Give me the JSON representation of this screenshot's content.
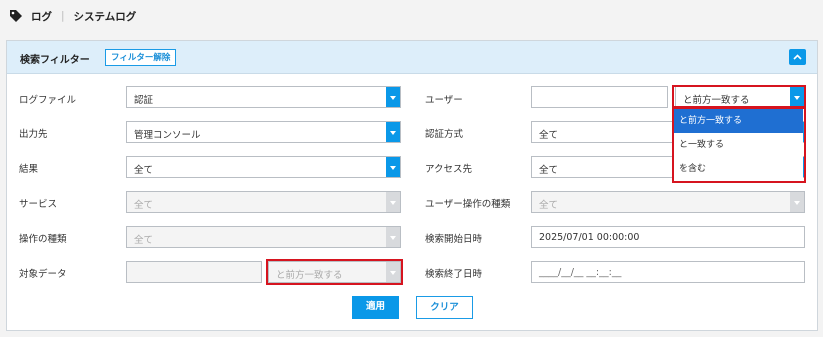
{
  "breadcrumb": {
    "root": "ログ",
    "current": "システムログ"
  },
  "filter": {
    "title": "検索フィルター",
    "clear_filter_label": "フィルター解除",
    "left": {
      "log_file": {
        "label": "ログファイル",
        "value": "認証"
      },
      "output": {
        "label": "出力先",
        "value": "管理コンソール"
      },
      "result": {
        "label": "結果",
        "value": "全て"
      },
      "service": {
        "label": "サービス",
        "value": "全て"
      },
      "operation_type": {
        "label": "操作の種類",
        "value": "全て"
      },
      "target_data": {
        "label": "対象データ",
        "value": "",
        "match": "と前方一致する"
      }
    },
    "right": {
      "user": {
        "label": "ユーザー",
        "value": "",
        "match": "と前方一致する"
      },
      "auth_method": {
        "label": "認証方式",
        "value": "全て"
      },
      "access_dest": {
        "label": "アクセス先",
        "value": "全て"
      },
      "user_operation_type": {
        "label": "ユーザー操作の種類",
        "value": "全て"
      },
      "search_start": {
        "label": "検索開始日時",
        "value": "2025/07/01 00:00:00"
      },
      "search_end": {
        "label": "検索終了日時",
        "placeholder": "____/__/__ __:__:__"
      }
    },
    "match_dropdown": {
      "options": [
        "と前方一致する",
        "と一致する",
        "を含む"
      ],
      "selected_index": 0
    },
    "apply_label": "適用",
    "clear_label": "クリア"
  },
  "colors": {
    "accent": "#0a98e8",
    "header_bg": "#ddeefa",
    "highlight": "#d6141f",
    "selected_option": "#1f6fd2"
  }
}
